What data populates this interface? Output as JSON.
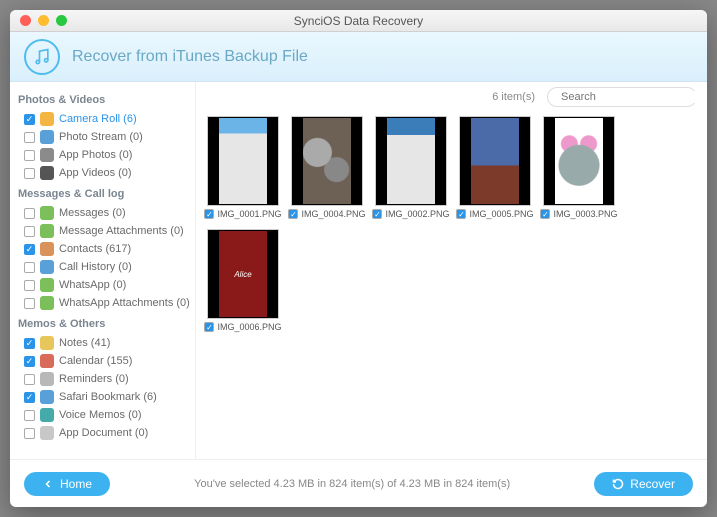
{
  "window": {
    "title": "SynciOS Data Recovery"
  },
  "header": {
    "title": "Recover from iTunes Backup File"
  },
  "sidebar": {
    "cat0": "Photos & Videos",
    "cat1": "Messages & Call log",
    "cat2": "Memos & Others",
    "items": [
      {
        "label": "Camera Roll (6)"
      },
      {
        "label": "Photo Stream (0)"
      },
      {
        "label": "App Photos (0)"
      },
      {
        "label": "App Videos (0)"
      },
      {
        "label": "Messages (0)"
      },
      {
        "label": "Message Attachments (0)"
      },
      {
        "label": "Contacts (617)"
      },
      {
        "label": "Call History (0)"
      },
      {
        "label": "WhatsApp (0)"
      },
      {
        "label": "WhatsApp Attachments (0)"
      },
      {
        "label": "Notes (41)"
      },
      {
        "label": "Calendar (155)"
      },
      {
        "label": "Reminders (0)"
      },
      {
        "label": "Safari Bookmark (6)"
      },
      {
        "label": "Voice Memos (0)"
      },
      {
        "label": "App Document (0)"
      }
    ]
  },
  "toolbar": {
    "count": "6 item(s)",
    "search_placeholder": "Search"
  },
  "thumbs": [
    {
      "name": "IMG_0001.PNG"
    },
    {
      "name": "IMG_0004.PNG"
    },
    {
      "name": "IMG_0002.PNG"
    },
    {
      "name": "IMG_0005.PNG"
    },
    {
      "name": "IMG_0003.PNG"
    },
    {
      "name": "IMG_0006.PNG"
    }
  ],
  "footer": {
    "status": "You've selected 4.23 MB in 824 item(s) of 4.23 MB in 824 item(s)",
    "home": "Home",
    "recover": "Recover"
  },
  "icons": {
    "colors": [
      "#f3b642",
      "#5aa0d8",
      "#8a8a8a",
      "#555",
      "#7bbf5a",
      "#7bbf5a",
      "#d8925a",
      "#5aa0d8",
      "#7bbf5a",
      "#7bbf5a",
      "#e7c75b",
      "#d86b5a",
      "#b8b8b8",
      "#5aa0d8",
      "#4aa",
      "#c8c8c8"
    ]
  }
}
